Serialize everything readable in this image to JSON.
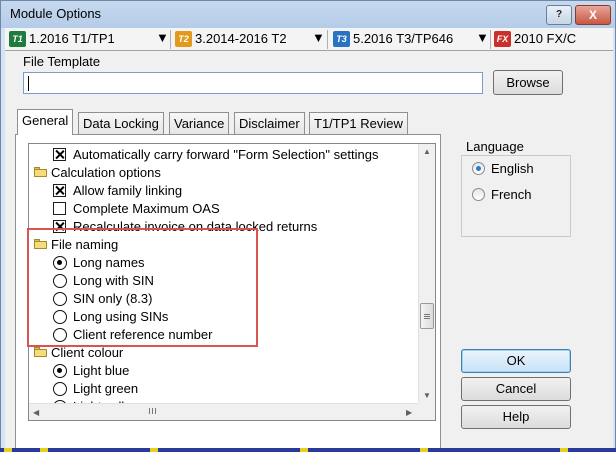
{
  "window": {
    "title": "Module Options",
    "help_label": "?",
    "close_label": "X"
  },
  "module_tabs": [
    {
      "icon_text": "T1",
      "color": "#1e7c3e",
      "label": "1.2016 T1/TP1"
    },
    {
      "icon_text": "T2",
      "color": "#e29a1d",
      "label": "3.2014-2016 T2"
    },
    {
      "icon_text": "T3",
      "color": "#2a73c2",
      "label": "5.2016 T3/TP646"
    },
    {
      "icon_text": "FX",
      "color": "#c9302c",
      "label": "2010 FX/C"
    }
  ],
  "dropdown_arrow": "▼",
  "file_template": {
    "label": "File Template",
    "value": "",
    "browse_label": "Browse"
  },
  "tabs": [
    "General",
    "Data Locking",
    "Variance",
    "Disclaimer",
    "T1/TP1 Review"
  ],
  "tree": {
    "automatic_carry": "Automatically carry forward \"Form Selection\" settings",
    "calc_options": {
      "label": "Calculation options",
      "items": [
        {
          "label": "Allow family linking",
          "checked": true
        },
        {
          "label": "Complete Maximum OAS",
          "checked": false
        },
        {
          "label": "Recalculate invoice on data locked returns",
          "checked": true
        }
      ]
    },
    "file_naming": {
      "label": "File naming",
      "options": [
        {
          "label": "Long names",
          "selected": true
        },
        {
          "label": "Long with SIN",
          "selected": false
        },
        {
          "label": "SIN only (8.3)",
          "selected": false
        },
        {
          "label": "Long using SINs",
          "selected": false
        },
        {
          "label": "Client reference number",
          "selected": false
        }
      ]
    },
    "client_colour": {
      "label": "Client colour",
      "options": [
        {
          "label": "Light blue",
          "selected": true
        },
        {
          "label": "Light green",
          "selected": false
        },
        {
          "label": "Light yellow",
          "selected": false
        }
      ]
    }
  },
  "language": {
    "label": "Language",
    "options": [
      {
        "label": "English",
        "selected": true
      },
      {
        "label": "French",
        "selected": false
      }
    ]
  },
  "buttons": {
    "ok": "OK",
    "cancel": "Cancel",
    "help": "Help"
  },
  "colors": {
    "highlight_border": "#d9534f",
    "default_button_border": "#3c7fb1"
  }
}
